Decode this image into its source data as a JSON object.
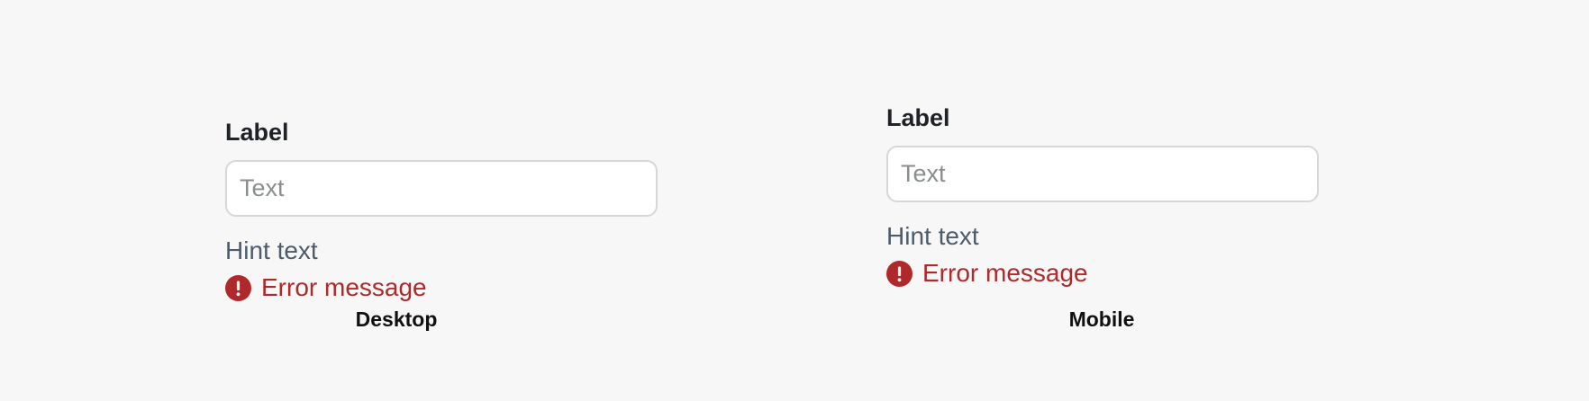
{
  "colors": {
    "background": "#f6f7f6",
    "input_border": "#d5d8d8",
    "hint": "#4d5b6b",
    "error": "#b0292a"
  },
  "desktop": {
    "label": "Label",
    "input_placeholder": "Text",
    "input_value": "",
    "hint": "Hint text",
    "error_icon": "error-exclamation-icon",
    "error": "Error message",
    "caption": "Desktop"
  },
  "mobile": {
    "label": "Label",
    "input_placeholder": "Text",
    "input_value": "",
    "hint": "Hint text",
    "error_icon": "error-exclamation-icon",
    "error": "Error message",
    "caption": "Mobile"
  }
}
